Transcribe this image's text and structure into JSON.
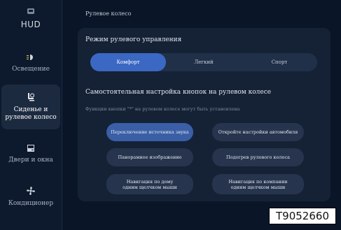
{
  "sidebar": {
    "items": [
      {
        "label": "HUD",
        "icon": "hud-icon"
      },
      {
        "label": "Освещение",
        "icon": "light-icon"
      },
      {
        "label": "Сиденье и\nрулевое колесо",
        "icon": "seat-icon",
        "active": true
      },
      {
        "label": "Двери и окна",
        "icon": "door-icon"
      },
      {
        "label": "Кондиционер",
        "icon": "fan-icon"
      }
    ]
  },
  "header": {
    "title": "Рулевое колесо"
  },
  "steering_mode": {
    "title": "Режим рулевого управления",
    "options": [
      "Комфорт",
      "Легкий",
      "Спорт"
    ],
    "selected": "Комфорт"
  },
  "custom_keys": {
    "title": "Самостоятельная настройка кнопок на рулевом колесе",
    "note": "Функции кнопки \"*\" на рулевом колесе могут быть установлена",
    "buttons": [
      {
        "label": "Переключение источника звука",
        "selected": true
      },
      {
        "label": "Откройте настройки автомобиля"
      },
      {
        "label": "Панорамное изображение"
      },
      {
        "label": "Подогрев рулевого колеса"
      },
      {
        "label": "Навигация по дому\nодним щелчком мыши"
      },
      {
        "label": "Навигация по компании\nодним щелчком мыши"
      }
    ]
  },
  "figure_code": "T9052660",
  "colors": {
    "background": "#0a1628",
    "card": "#152236",
    "accent": "#3b68c2",
    "button": "#26344d"
  }
}
